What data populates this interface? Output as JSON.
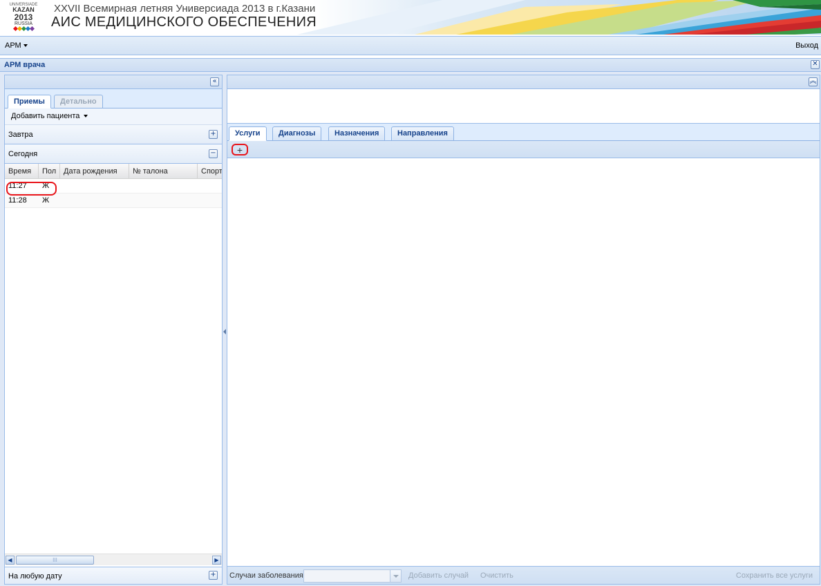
{
  "header": {
    "subtitle": "XXVII Всемирная летняя Универсиада 2013 в г.Казани",
    "title": "АИС МЕДИЦИНСКОГО ОБЕСПЕЧЕНИЯ",
    "logo": {
      "line1": "UNIVERSIADE",
      "line2": "KAZAN",
      "line3": "2013",
      "line4": "RUSSIA"
    }
  },
  "menubar": {
    "arm_menu": "АРМ",
    "exit": "Выход"
  },
  "window": {
    "title": "АРМ врача"
  },
  "left": {
    "tabs": [
      {
        "label": "Приемы",
        "active": true
      },
      {
        "label": "Детально",
        "active": false
      }
    ],
    "add_patient": "Добавить пациента",
    "groups": {
      "tomorrow": "Завтра",
      "today": "Сегодня",
      "any_date": "На любую дату"
    },
    "grid": {
      "columns": [
        "Время",
        "Пол",
        "Дата рождения",
        "№ талона",
        "Спорт"
      ],
      "rows": [
        {
          "time": "11:27",
          "sex": "Ж",
          "birth": "",
          "ticket": "",
          "sport": ""
        },
        {
          "time": "11:28",
          "sex": "Ж",
          "birth": "",
          "ticket": "",
          "sport": ""
        }
      ]
    },
    "scroll_thumb_grip": "III"
  },
  "right": {
    "tabs": [
      {
        "label": "Услуги",
        "active": true
      },
      {
        "label": "Диагнозы",
        "active": false
      },
      {
        "label": "Назначения",
        "active": false
      },
      {
        "label": "Направления",
        "active": false
      }
    ],
    "add_button": "+",
    "bottom": {
      "cases_label": "Случаи заболевания",
      "add_case": "Добавить случай",
      "clear": "Очистить",
      "save_all": "Сохранить все услуги"
    }
  },
  "colors": {
    "accent_blue": "#15428b",
    "border_blue": "#99bbe8",
    "highlight_red": "#e8141a"
  }
}
